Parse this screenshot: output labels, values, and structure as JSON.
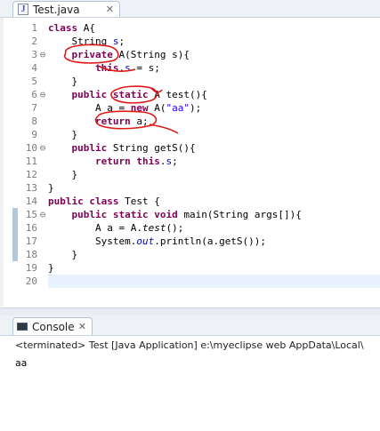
{
  "editor": {
    "tab_label": "Test.java",
    "tab_icon": "java-file-icon",
    "tab_icon_glyph": "J",
    "close_glyph": "✕"
  },
  "code": {
    "lines": [
      [
        {
          "t": "class",
          "k": "kw"
        },
        {
          "t": " A{"
        }
      ],
      [
        {
          "t": "    String "
        },
        {
          "t": "s",
          "k": "fld"
        },
        {
          "t": ";"
        }
      ],
      [
        {
          "t": "    "
        },
        {
          "t": "private",
          "k": "kw"
        },
        {
          "t": " A(String s){"
        }
      ],
      [
        {
          "t": "        "
        },
        {
          "t": "this",
          "k": "kw"
        },
        {
          "t": "."
        },
        {
          "t": "s",
          "k": "fld"
        },
        {
          "t": " = s;"
        }
      ],
      [
        {
          "t": "    }"
        }
      ],
      [
        {
          "t": "    "
        },
        {
          "t": "public",
          "k": "kw"
        },
        {
          "t": " "
        },
        {
          "t": "static",
          "k": "kw"
        },
        {
          "t": " A test(){"
        }
      ],
      [
        {
          "t": "        A a = "
        },
        {
          "t": "new",
          "k": "kw"
        },
        {
          "t": " A("
        },
        {
          "t": "\"aa\"",
          "k": "str"
        },
        {
          "t": ");"
        }
      ],
      [
        {
          "t": "        "
        },
        {
          "t": "return",
          "k": "kw"
        },
        {
          "t": " a;"
        }
      ],
      [
        {
          "t": "    }"
        }
      ],
      [
        {
          "t": "    "
        },
        {
          "t": "public",
          "k": "kw"
        },
        {
          "t": " String getS(){"
        }
      ],
      [
        {
          "t": "        "
        },
        {
          "t": "return",
          "k": "kw"
        },
        {
          "t": " "
        },
        {
          "t": "this",
          "k": "kw"
        },
        {
          "t": "."
        },
        {
          "t": "s",
          "k": "fld"
        },
        {
          "t": ";"
        }
      ],
      [
        {
          "t": "    }"
        }
      ],
      [
        {
          "t": "}"
        }
      ],
      [
        {
          "t": "public",
          "k": "kw"
        },
        {
          "t": " "
        },
        {
          "t": "class",
          "k": "kw"
        },
        {
          "t": " Test {"
        }
      ],
      [
        {
          "t": "    "
        },
        {
          "t": "public",
          "k": "kw"
        },
        {
          "t": " "
        },
        {
          "t": "static",
          "k": "kw"
        },
        {
          "t": " "
        },
        {
          "t": "void",
          "k": "kw"
        },
        {
          "t": " main(String args[]){"
        }
      ],
      [
        {
          "t": "        A a = A."
        },
        {
          "t": "test",
          "k": "st"
        },
        {
          "t": "();"
        }
      ],
      [
        {
          "t": "        System."
        },
        {
          "t": "out",
          "k": "sf"
        },
        {
          "t": ".println(a.getS());"
        }
      ],
      [
        {
          "t": "    }"
        }
      ],
      [
        {
          "t": "}"
        }
      ],
      [
        {
          "t": ""
        }
      ]
    ],
    "line_numbers": [
      "1",
      "2",
      "3",
      "4",
      "5",
      "6",
      "7",
      "8",
      "9",
      "10",
      "11",
      "12",
      "13",
      "14",
      "15",
      "16",
      "17",
      "18",
      "19",
      "20"
    ],
    "fold_markers": [
      "",
      "",
      "⊖",
      "",
      "",
      "⊖",
      "",
      "",
      "",
      "⊖",
      "",
      "",
      "",
      "",
      "⊖",
      "",
      "",
      "",
      "",
      ""
    ],
    "current_line": 20,
    "changed_lines": [
      15,
      16,
      17,
      18
    ],
    "annotation_color": "#e01818"
  },
  "console": {
    "tab_label": "Console",
    "tab_icon": "console-icon",
    "close_glyph": "✕",
    "status": "<terminated> Test [Java Application] e:\\myeclipse web AppData\\Local\\",
    "output": "aa"
  },
  "colors": {
    "keyword": "#7f0055",
    "string": "#2a00ff",
    "field": "#0000c0",
    "current_line_bg": "#e8f2fe"
  }
}
